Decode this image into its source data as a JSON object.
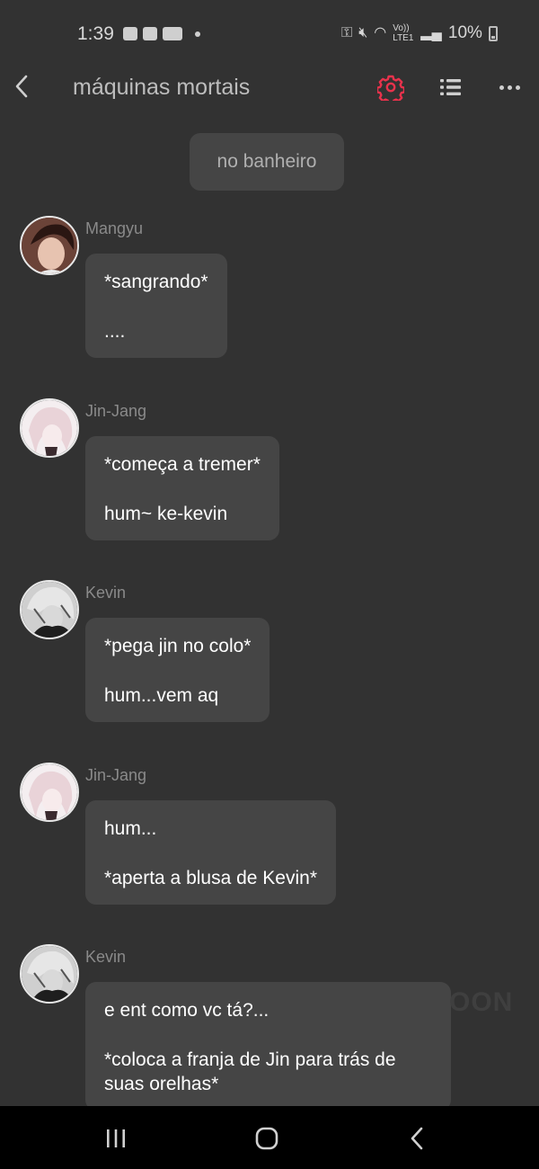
{
  "status_bar": {
    "time": "1:39",
    "network": "Vo)) LTE1",
    "battery": "10%"
  },
  "app_bar": {
    "title": "máquinas mortais",
    "settings_icon_color": "#e8324c"
  },
  "system_message": "no banheiro",
  "messages": [
    {
      "sender": "Mangyu",
      "lines": [
        "*sangrando*",
        "...."
      ]
    },
    {
      "sender": "Jin-Jang",
      "lines": [
        "*começa a tremer*",
        "hum~ ke-kevin"
      ]
    },
    {
      "sender": "Kevin",
      "lines": [
        "*pega jin no colo*",
        "hum...vem aq"
      ]
    },
    {
      "sender": "Jin-Jang",
      "lines": [
        "hum...",
        "*aperta a blusa de Kevin*"
      ]
    },
    {
      "sender": "Kevin",
      "lines": [
        "e ent como vc tá?...",
        "*coloca a franja de Jin para trás de\nsuas orelhas*"
      ]
    }
  ],
  "watermark": "OON"
}
